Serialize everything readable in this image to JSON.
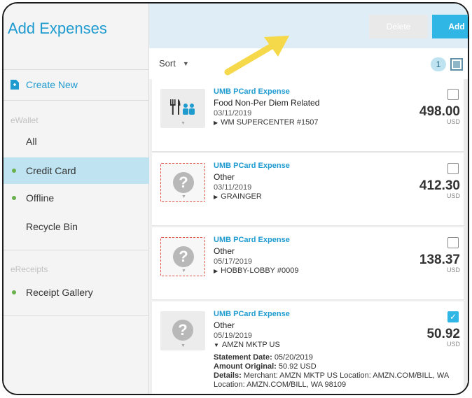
{
  "sidebar": {
    "title": "Add Expenses",
    "create_new": "Create New",
    "sections": {
      "ewallet": "eWallet",
      "ereceipts": "eReceipts"
    },
    "items": [
      {
        "label": "All",
        "dot": false,
        "active": false
      },
      {
        "label": "Credit Card",
        "dot": true,
        "active": true
      },
      {
        "label": "Offline",
        "dot": true,
        "active": false
      },
      {
        "label": "Recycle Bin",
        "dot": false,
        "active": false
      }
    ],
    "receipt_gallery": "Receipt Gallery"
  },
  "toolbar": {
    "delete_label": "Delete",
    "add_label": "Add"
  },
  "sortbar": {
    "sort_label": "Sort",
    "selected_count": "1"
  },
  "expenses": [
    {
      "type": "UMB PCard Expense",
      "category": "Food Non-Per Diem Related",
      "date": "03/11/2019",
      "merchant": "WM SUPERCENTER #1507",
      "amount": "498.00",
      "currency": "USD",
      "checked": false,
      "icon": "food-icon"
    },
    {
      "type": "UMB PCard Expense",
      "category": "Other",
      "date": "03/11/2019",
      "merchant": "GRAINGER",
      "amount": "412.30",
      "currency": "USD",
      "checked": false,
      "icon": "question-icon"
    },
    {
      "type": "UMB PCard Expense",
      "category": "Other",
      "date": "05/17/2019",
      "merchant": "HOBBY-LOBBY #0009",
      "amount": "138.37",
      "currency": "USD",
      "checked": false,
      "icon": "question-icon"
    },
    {
      "type": "UMB PCard Expense",
      "category": "Other",
      "date": "05/19/2019",
      "merchant": "AMZN MKTP US",
      "amount": "50.92",
      "currency": "USD",
      "checked": true,
      "icon": "question-icon",
      "details": {
        "statement_label": "Statement Date:",
        "statement_value": "05/20/2019",
        "original_label": "Amount Original:",
        "original_value": "50.92 USD",
        "details_label": "Details:",
        "details_value": "Merchant: AMZN MKTP US Location: AMZN.COM/BILL, WA Location: AMZN.COM/BILL, WA 98109"
      }
    }
  ],
  "colors": {
    "accent": "#30b6e4",
    "link": "#1f9bd0",
    "active_bg": "#bfe3f0",
    "dot": "#6ab04c",
    "missing_receipt_border": "#e0524a",
    "arrow": "#f5d94a"
  }
}
